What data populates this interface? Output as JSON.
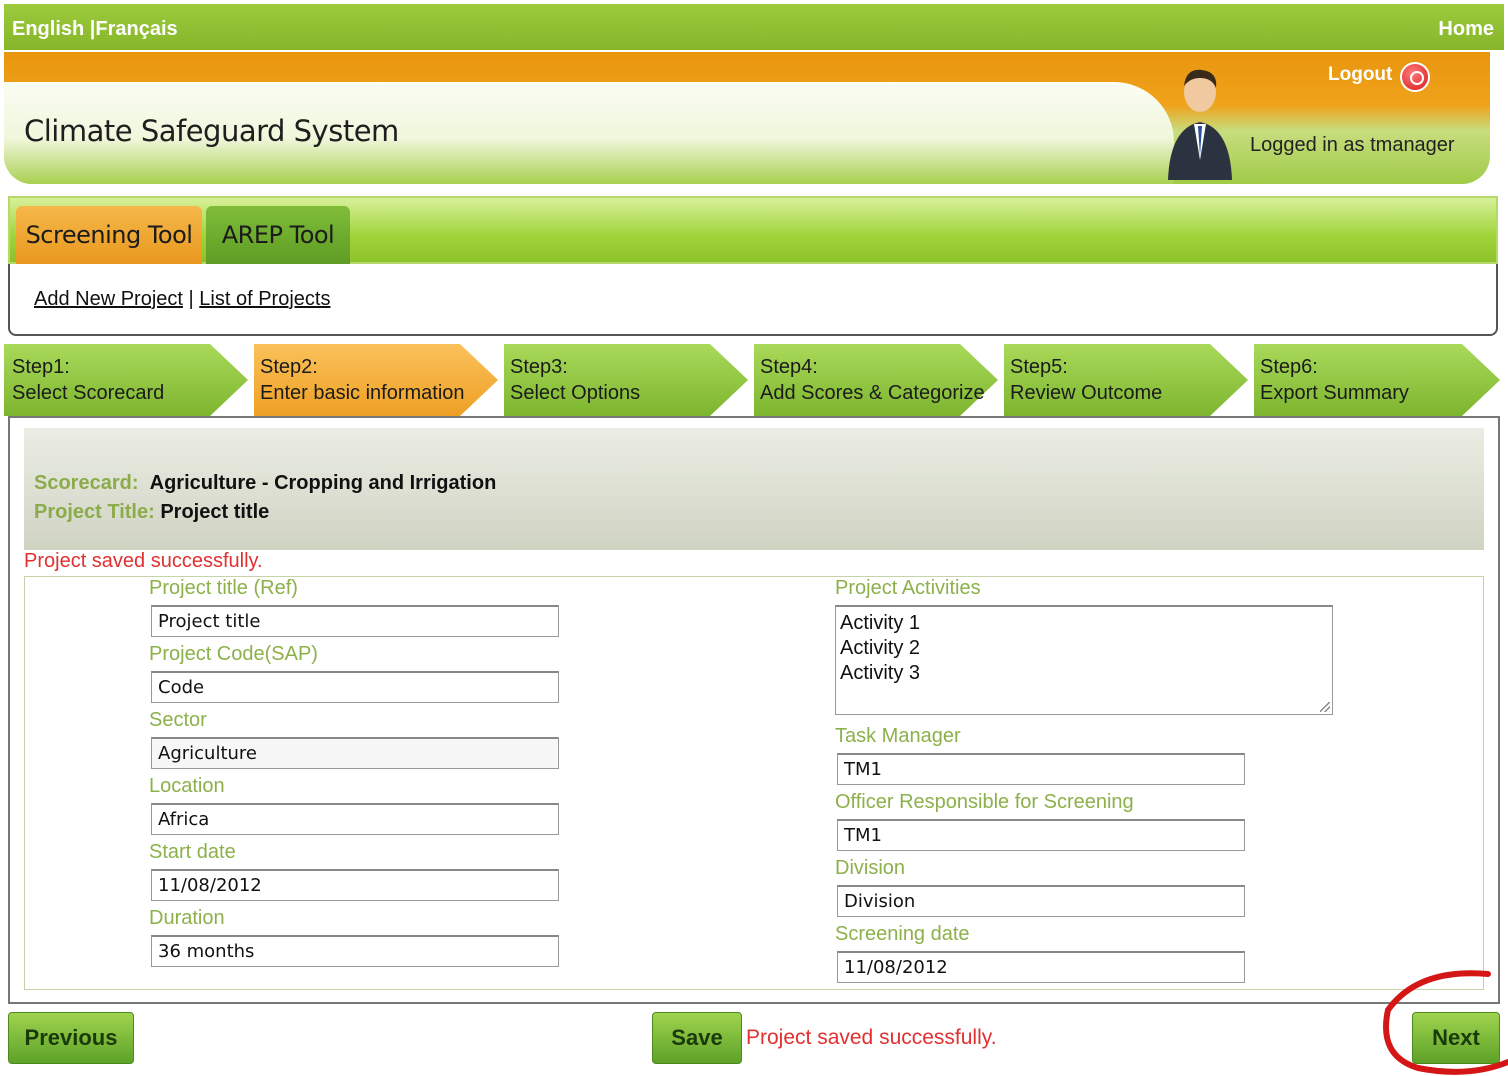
{
  "topbar": {
    "lang_en": "English",
    "lang_fr": "Français",
    "home": "Home"
  },
  "header": {
    "title": "Climate Safeguard System",
    "logout": "Logout",
    "logged_in": "Logged in as tmanager"
  },
  "tools": {
    "active": "Screening Tool",
    "other": "AREP Tool"
  },
  "sublinks": {
    "add": "Add New Project",
    "list": "List of Projects"
  },
  "steps": [
    {
      "num": "Step1:",
      "label": "Select Scorecard"
    },
    {
      "num": "Step2:",
      "label": "Enter basic information"
    },
    {
      "num": "Step3:",
      "label": "Select Options"
    },
    {
      "num": "Step4:",
      "label": "Add Scores & Categorize"
    },
    {
      "num": "Step5:",
      "label": "Review Outcome"
    },
    {
      "num": "Step6:",
      "label": "Export Summary"
    }
  ],
  "info": {
    "scorecard_key": "Scorecard:",
    "scorecard_val": "Agriculture - Cropping and Irrigation",
    "title_key": "Project Title:",
    "title_val": "Project title"
  },
  "saved_msg": "Project saved successfully.",
  "form": {
    "project_title": {
      "label": "Project title (Ref)",
      "value": "Project title"
    },
    "project_code": {
      "label": "Project Code(SAP)",
      "value": "Code"
    },
    "sector": {
      "label": "Sector",
      "value": "Agriculture"
    },
    "location": {
      "label": "Location",
      "value": "Africa"
    },
    "start_date": {
      "label": "Start date",
      "value": "11/08/2012"
    },
    "duration": {
      "label": "Duration",
      "value": "36 months"
    },
    "activities": {
      "label": "Project Activities",
      "lines": [
        "Activity 1",
        "Activity 2",
        "Activity 3"
      ]
    },
    "task_manager": {
      "label": "Task Manager",
      "value": "TM1"
    },
    "officer": {
      "label": "Officer Responsible for Screening",
      "value": "TM1"
    },
    "division": {
      "label": "Division",
      "value": "Division"
    },
    "screening_date": {
      "label": "Screening date",
      "value": "11/08/2012"
    }
  },
  "buttons": {
    "previous": "Previous",
    "save": "Save",
    "next": "Next"
  },
  "colors": {
    "green": "#8cc12a",
    "orange": "#f0a21b",
    "label_green": "#8cb04a",
    "error_red": "#e03030"
  }
}
